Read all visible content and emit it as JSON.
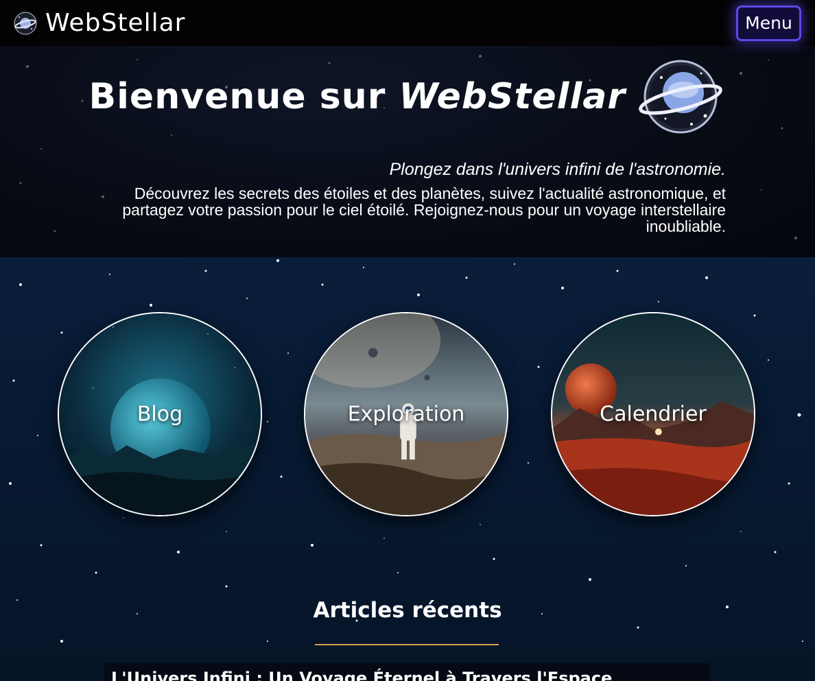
{
  "navbar": {
    "brand_name": "WebStellar",
    "menu_label": "Menu",
    "logo_icon": "planet-logo-icon"
  },
  "hero": {
    "title_prefix": "Bienvenue sur ",
    "title_brand": "WebStellar",
    "tagline": "Plongez dans l'univers infini de l'astronomie.",
    "description": "Découvrez les secrets des étoiles et des planètes, suivez l'actualité astronomique, et partagez votre passion pour le ciel étoilé. Rejoignez-nous pour un voyage interstellaire inoubliable."
  },
  "sections": [
    {
      "label": "Blog",
      "icon": "moon-landscape-image"
    },
    {
      "label": "Exploration",
      "icon": "astronaut-image"
    },
    {
      "label": "Calendrier",
      "icon": "mars-landscape-image"
    }
  ],
  "recent": {
    "title": "Articles récents",
    "first_article_title": "L'Univers Infini : Un Voyage Éternel à Travers l'Espace"
  },
  "colors": {
    "menu_border": "#5b48e8",
    "underline": "#d9a24a",
    "background": "#050a14"
  }
}
